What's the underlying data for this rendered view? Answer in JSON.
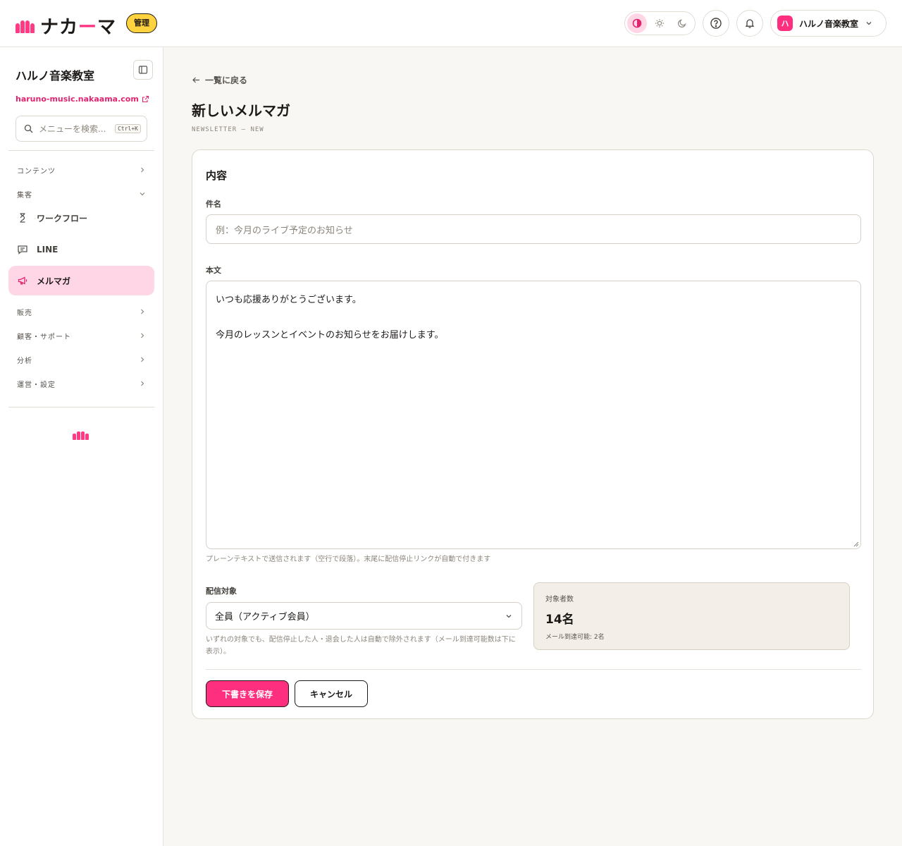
{
  "header": {
    "brand": {
      "name_prefix": "ナカ",
      "name_accent": "ー",
      "name_suffix": "マ"
    },
    "admin_badge": "管理",
    "account": {
      "avatar_initial": "ハ",
      "name": "ハルノ音楽教室"
    }
  },
  "sidebar": {
    "title": "ハルノ音楽教室",
    "site_url": "haruno-music.nakaama.com",
    "search": {
      "placeholder": "メニューを検索...",
      "shortcut": "Ctrl+K"
    },
    "sections": {
      "contents": "コンテンツ",
      "acquisition": "集客",
      "sales": "販売",
      "customers": "顧客・サポート",
      "analytics": "分析",
      "operations": "運営・設定"
    },
    "items": {
      "workflow": "ワークフロー",
      "line": "LINE",
      "newsletter": "メルマガ"
    }
  },
  "main": {
    "back_link": "一覧に戻る",
    "title": "新しいメルマガ",
    "subtitle": "NEWSLETTER — NEW",
    "card": {
      "title": "内容",
      "subject": {
        "label": "件名",
        "placeholder": "例：今月のライブ予定のお知らせ"
      },
      "body": {
        "label": "本文",
        "line1": "いつも応援ありがとうございます。",
        "line2": "今月のレッスンとイベントのお知らせをお届けします。",
        "hint": "プレーンテキストで送信されます（空行で段落）。末尾に配信停止リンクが自動で付きます"
      },
      "audience": {
        "label": "配信対象",
        "selected": "全員（アクティブ会員）",
        "hint": "いずれの対象でも、配信停止した人・退会した人は自動で除外されます（メール到達可能数は下に表示）。"
      },
      "recipients": {
        "label": "対象者数",
        "value": "14名",
        "note": "メール到達可能: 2名"
      },
      "buttons": {
        "save_draft": "下書きを保存",
        "cancel": "キャンセル"
      }
    }
  },
  "colors": {
    "accent": "#ff2f80",
    "active_bg": "#ffd6e5",
    "badge": "#ffd23f",
    "page_bg": "#f9f7f3"
  }
}
